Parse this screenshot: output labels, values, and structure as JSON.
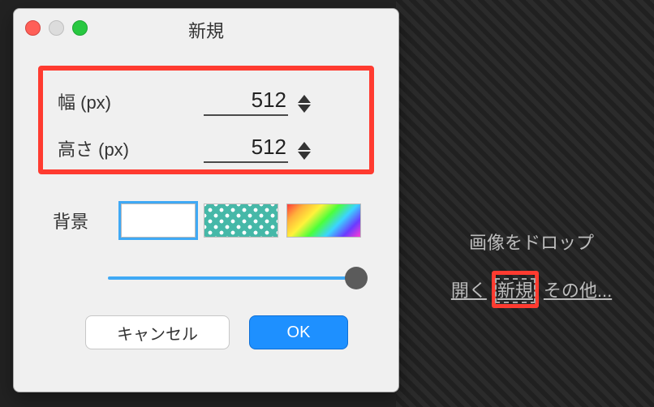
{
  "dialog": {
    "title": "新規",
    "width": {
      "label": "幅 (px)",
      "value": "512"
    },
    "height": {
      "label": "高さ (px)",
      "value": "512"
    },
    "background_label": "背景",
    "swatches": [
      "white",
      "polka-teal",
      "rainbow"
    ],
    "swatch_selected": 0,
    "cancel_label": "キャンセル",
    "ok_label": "OK"
  },
  "dropzone": {
    "title": "画像をドロップ",
    "open_label": "開く",
    "new_label": "新規",
    "other_label": "その他..."
  }
}
